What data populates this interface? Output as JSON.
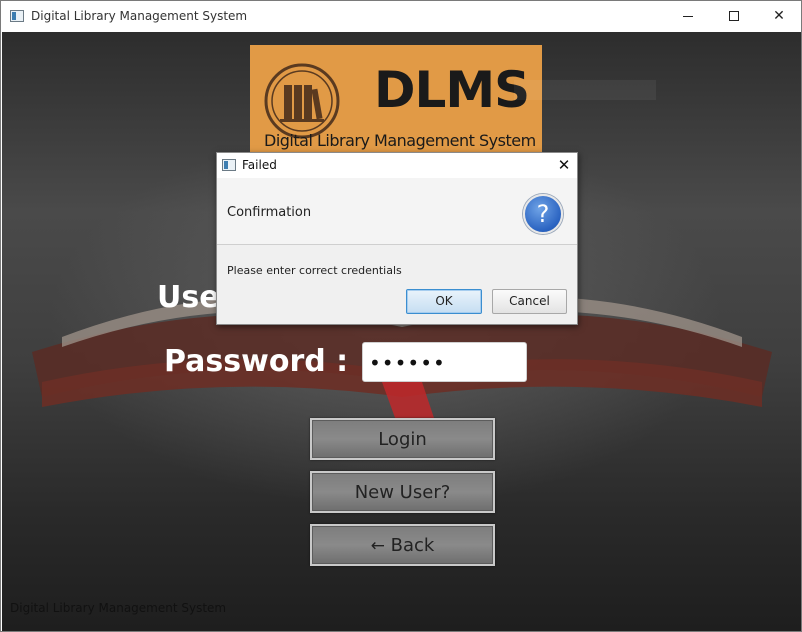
{
  "window": {
    "title": "Digital Library Management System"
  },
  "logo": {
    "name": "DLMS",
    "subtitle": "Digital Library Management System"
  },
  "form": {
    "username_label": "User",
    "password_label": "Password :",
    "password_value": "••••••"
  },
  "buttons": {
    "login": "Login",
    "new_user": "New User?",
    "back": "Back",
    "back_icon": "←"
  },
  "footer": {
    "text": "Digital Library Management System"
  },
  "dialog": {
    "title": "Failed",
    "header": "Confirmation",
    "message": "Please enter correct credentials",
    "ok_label": "OK",
    "cancel_label": "Cancel",
    "icon": "?"
  }
}
